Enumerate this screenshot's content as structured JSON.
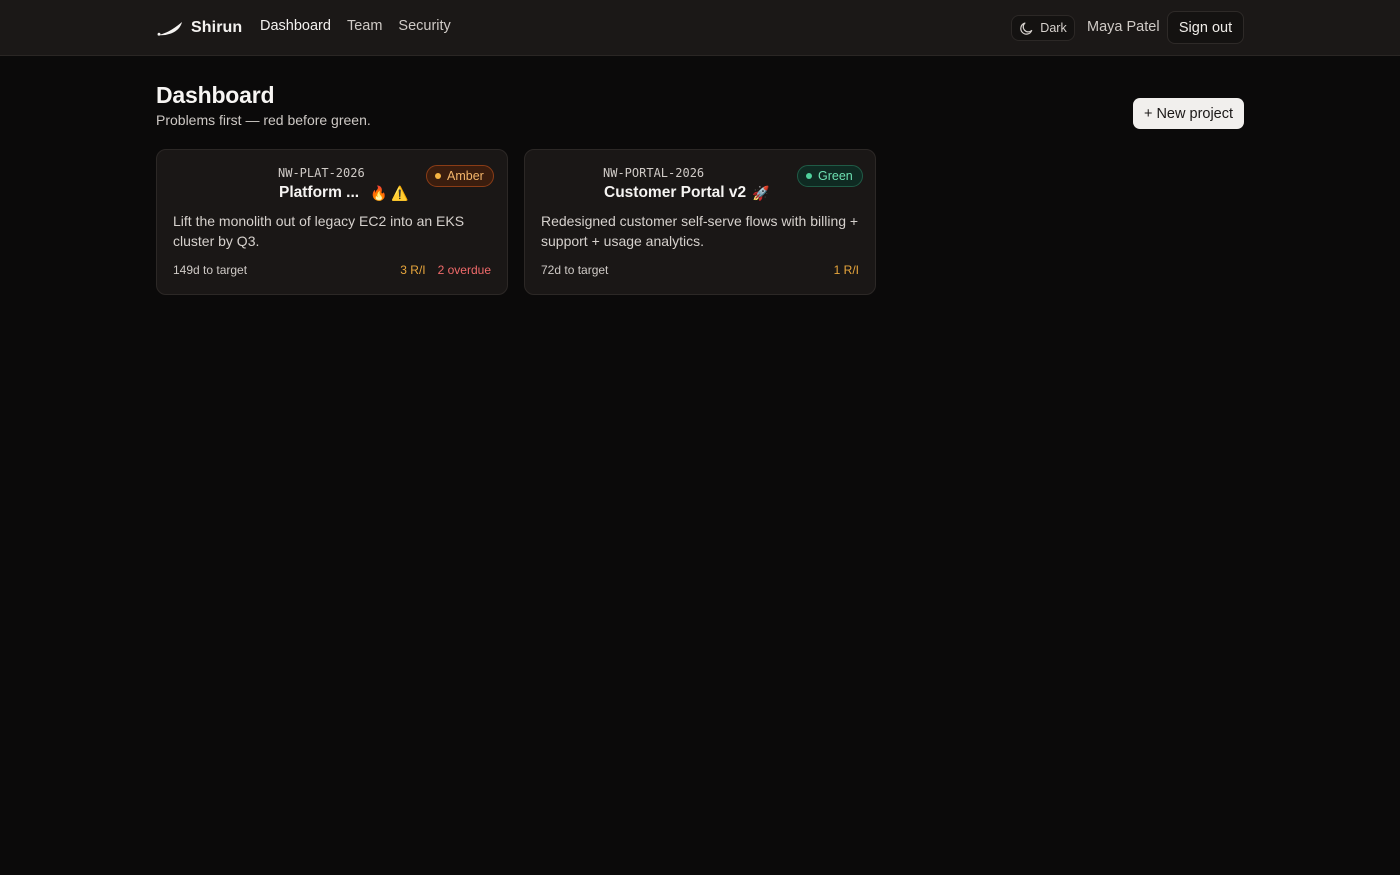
{
  "app": {
    "name": "Shirun",
    "nav": [
      {
        "label": "Dashboard"
      },
      {
        "label": "Team"
      },
      {
        "label": "Security"
      }
    ],
    "theme_label": "Dark",
    "user_name": "Maya Patel",
    "signout_label": "Sign out"
  },
  "page": {
    "title": "Dashboard",
    "subtitle": "Problems first — red before green.",
    "new_project_label": "+ New project"
  },
  "projects": [
    {
      "code": "NW-PLAT-2026",
      "title": "Platform ...",
      "emoji": "🔥 ⚠️",
      "status": "Amber",
      "status_color": "#f5b342",
      "description": "Lift the monolith out of legacy EC2 into an EKS cluster by Q3.",
      "days_to_target": "149d to target",
      "ri": "3 R/I",
      "overdue": "2 overdue"
    },
    {
      "code": "NW-PORTAL-2026",
      "title": "Customer Portal v2",
      "emoji": "🚀",
      "status": "Green",
      "status_color": "#4fd19c",
      "description": "Redesigned customer self-serve flows with billing + support + usage analytics.",
      "days_to_target": "72d to target",
      "ri": "1 R/I"
    }
  ]
}
